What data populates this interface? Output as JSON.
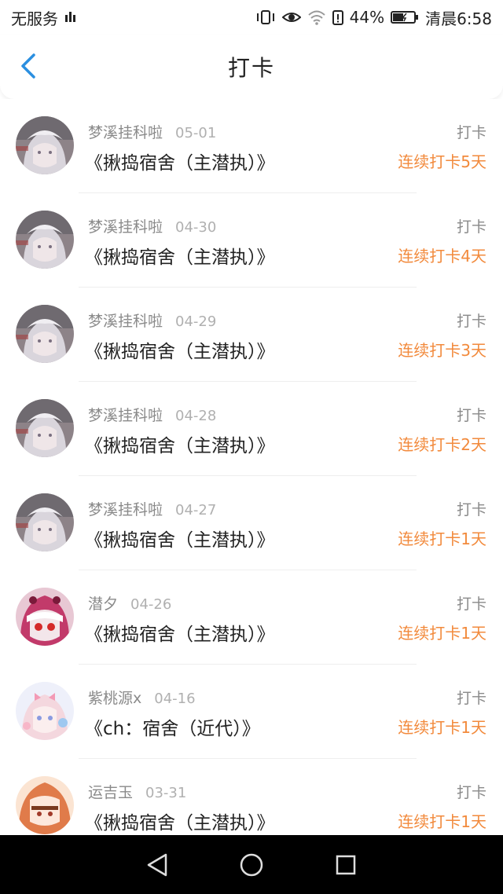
{
  "status_bar": {
    "carrier": "无服务",
    "battery": "44%",
    "time": "清晨6:58"
  },
  "header": {
    "title": "打卡"
  },
  "items": [
    {
      "user": "梦溪挂科啦",
      "date": "05-01",
      "book": "《揪捣宿舍（主潜执）》",
      "tag": "打卡",
      "streak": "连续打卡5天",
      "avatar": "silver-hair"
    },
    {
      "user": "梦溪挂科啦",
      "date": "04-30",
      "book": "《揪捣宿舍（主潜执）》",
      "tag": "打卡",
      "streak": "连续打卡4天",
      "avatar": "silver-hair"
    },
    {
      "user": "梦溪挂科啦",
      "date": "04-29",
      "book": "《揪捣宿舍（主潜执）》",
      "tag": "打卡",
      "streak": "连续打卡3天",
      "avatar": "silver-hair"
    },
    {
      "user": "梦溪挂科啦",
      "date": "04-28",
      "book": "《揪捣宿舍（主潜执）》",
      "tag": "打卡",
      "streak": "连续打卡2天",
      "avatar": "silver-hair"
    },
    {
      "user": "梦溪挂科啦",
      "date": "04-27",
      "book": "《揪捣宿舍（主潜执）》",
      "tag": "打卡",
      "streak": "连续打卡1天",
      "avatar": "silver-hair"
    },
    {
      "user": "潜夕",
      "date": "04-26",
      "book": "《揪捣宿舍（主潜执）》",
      "tag": "打卡",
      "streak": "连续打卡1天",
      "avatar": "pink-hood"
    },
    {
      "user": "紫桃源x",
      "date": "04-16",
      "book": "《ch：宿舍（近代）》",
      "tag": "打卡",
      "streak": "连续打卡1天",
      "avatar": "pastel-girl"
    },
    {
      "user": "运吉玉",
      "date": "03-31",
      "book": "《揪捣宿舍（主潜执）》",
      "tag": "打卡",
      "streak": "连续打卡1天",
      "avatar": "orange-girl"
    }
  ],
  "colors": {
    "accent_blue": "#2b8fe0",
    "streak_orange": "#f28a3c",
    "secondary_text": "#8a8a8a"
  }
}
